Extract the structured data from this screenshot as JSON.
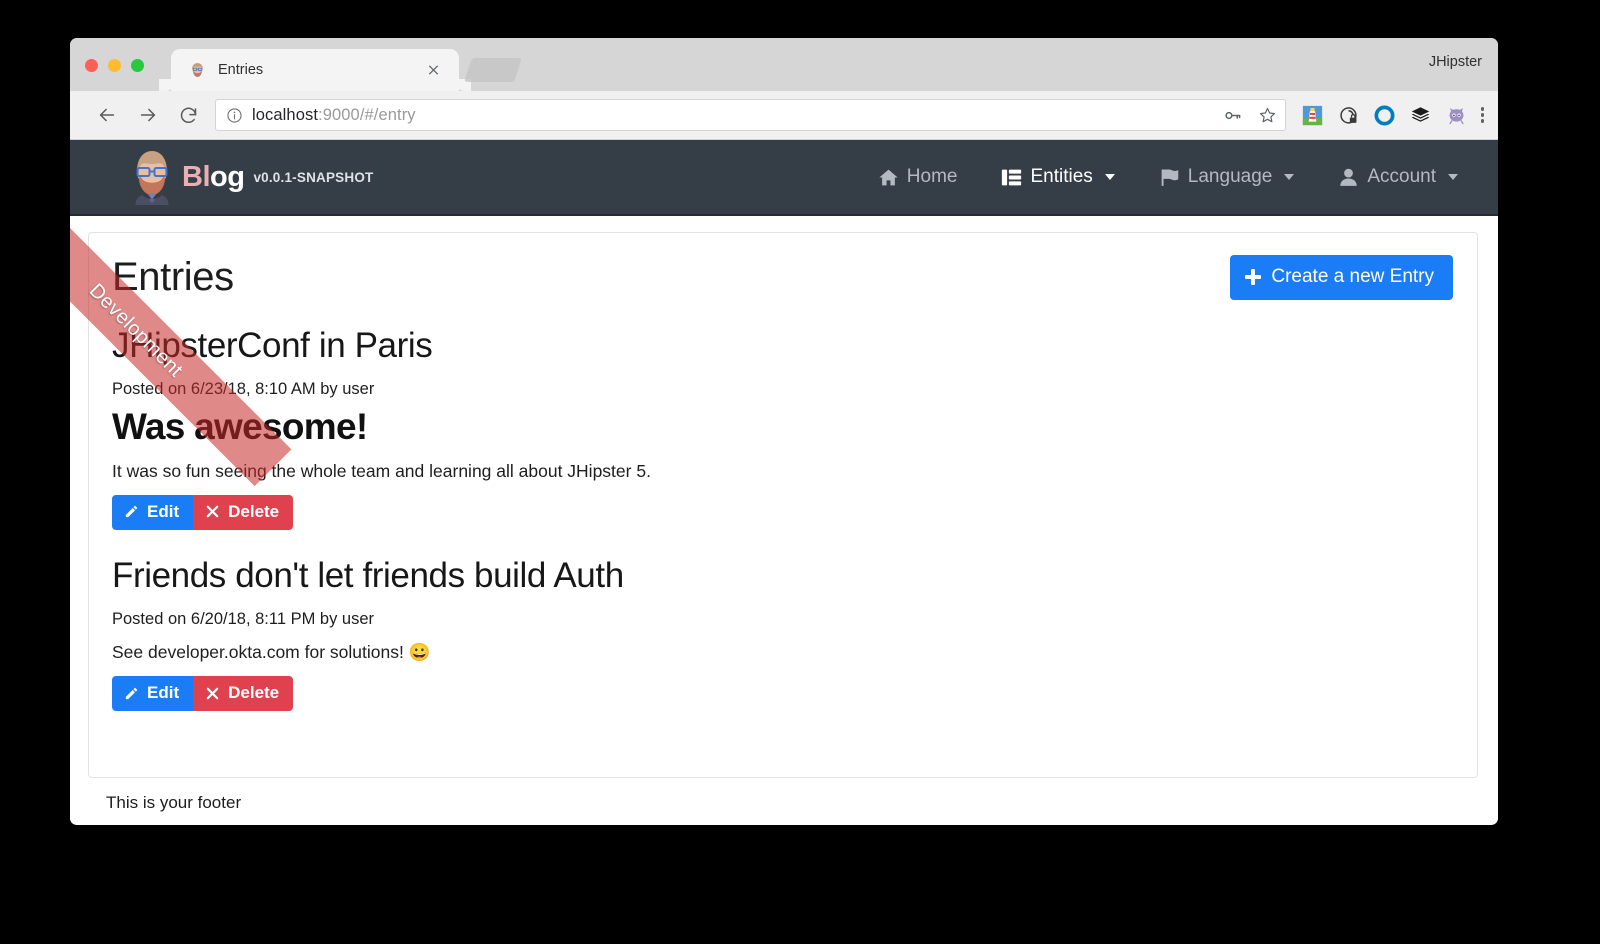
{
  "browser": {
    "window_title": "JHipster",
    "tab": {
      "title": "Entries",
      "favicon": "jhipster-favicon",
      "close": "×"
    },
    "toolbar": {
      "back": "back-arrow",
      "forward": "forward-arrow",
      "reload": "reload-arrow",
      "url_secure_part": "localhost",
      "url_rest": ":9000/#/entry",
      "key_icon": "password-key-icon",
      "star_icon": "bookmark-star-icon",
      "extensions": [
        {
          "name": "lighthouse-extension-icon"
        },
        {
          "name": "privacy-badger-extension-icon"
        },
        {
          "name": "okta-extension-icon"
        },
        {
          "name": "layers-extension-icon"
        },
        {
          "name": "octocat-extension-icon"
        }
      ],
      "menu": "chrome-menu-icon"
    }
  },
  "app": {
    "ribbon_label": "Development",
    "brand": {
      "name_part1": "Bl",
      "name_part2": "og",
      "version": "v0.0.1-SNAPSHOT"
    },
    "nav": [
      {
        "label": "Home",
        "icon": "home-icon",
        "active": false,
        "caret": false
      },
      {
        "label": "Entities",
        "icon": "entities-list-icon",
        "active": true,
        "caret": true
      },
      {
        "label": "Language",
        "icon": "flag-icon",
        "active": false,
        "caret": true
      },
      {
        "label": "Account",
        "icon": "user-icon",
        "active": false,
        "caret": true
      }
    ]
  },
  "page": {
    "title": "Entries",
    "create_button": "Create a new Entry",
    "entries": [
      {
        "title": "JHipsterConf in Paris",
        "meta": "Posted on 6/23/18, 8:10 AM by user",
        "subtitle": "Was awesome!",
        "body": "It was so fun seeing the whole team and learning all about JHipster 5.",
        "edit_label": "Edit",
        "delete_label": "Delete"
      },
      {
        "title": "Friends don't let friends build Auth",
        "meta": "Posted on 6/20/18, 8:11 PM by user",
        "subtitle": "",
        "body": "See developer.okta.com for solutions! 😀",
        "edit_label": "Edit",
        "delete_label": "Delete"
      }
    ]
  },
  "footer": {
    "text": "This is your footer"
  },
  "colors": {
    "navbar": "#353d47",
    "primary": "#1b7df5",
    "danger": "#e0414f",
    "ribbon": "#c62828"
  }
}
